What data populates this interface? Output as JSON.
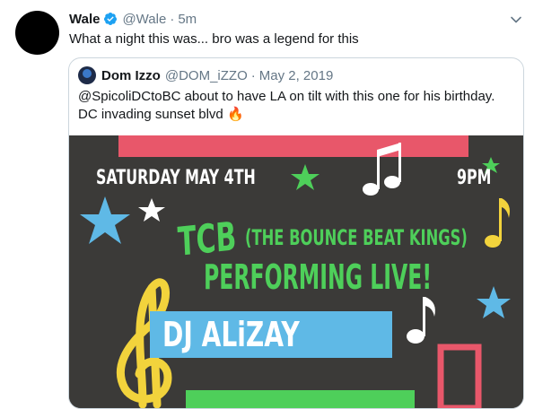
{
  "tweet": {
    "author_name": "Wale",
    "author_handle": "@Wale",
    "separator": "·",
    "time": "5m",
    "text": "What a night this was... bro was a legend for this"
  },
  "quote": {
    "author_name": "Dom Izzo",
    "author_handle": "@DOM_iZZO",
    "separator": "·",
    "date": "May 2, 2019",
    "text_line1": "@SpicoliDCtoBC about to have LA on tilt with this one for his birthday.",
    "text_line2": "DC invading sunset blvd",
    "emoji": "🔥"
  },
  "poster": {
    "date_text": "SATURDAY MAY 4TH",
    "time_text": "9PM",
    "band_short": "TCB",
    "band_full": "(THE BOUNCE BEAT KINGS)",
    "performing": "PERFORMING LIVE!",
    "dj": "DJ ALiZAY",
    "colors": {
      "background": "#3b3a38",
      "pink": "#e8576a",
      "green": "#4ecf5a",
      "blue": "#5fb9e6",
      "yellow": "#f2d33c",
      "white": "#ffffff"
    }
  },
  "icons": {
    "verified": "verified-badge-icon",
    "more": "chevron-down-icon"
  }
}
